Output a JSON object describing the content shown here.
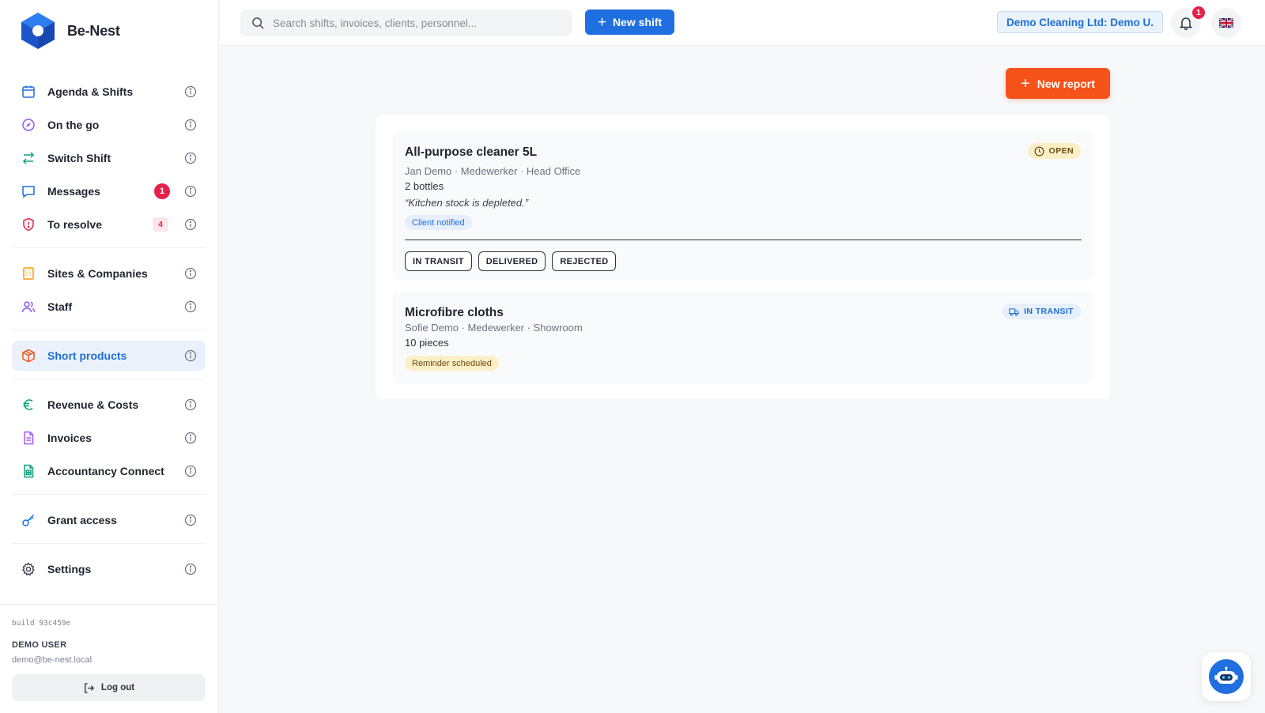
{
  "app": {
    "name": "Be-Nest",
    "colors": {
      "accent": "#1f6fe0",
      "orange": "#f5531a",
      "danger": "#e5214b"
    }
  },
  "search": {
    "placeholder": "Search shifts, invoices, clients, personnel..."
  },
  "topbar": {
    "new_shift_label": "New shift",
    "company_label": "Demo Cleaning Ltd: Demo U.",
    "notifications_count": "1",
    "language_icon": "uk-flag-icon"
  },
  "sidebar": {
    "items": [
      {
        "label": "Agenda & Shifts",
        "icon": "calendar-icon"
      },
      {
        "label": "On the go",
        "icon": "compass-icon"
      },
      {
        "label": "Switch Shift",
        "icon": "swap-icon"
      },
      {
        "label": "Messages",
        "icon": "message-icon",
        "badge": "1"
      },
      {
        "label": "To resolve",
        "icon": "shield-alert-icon",
        "badge": "4"
      },
      {
        "label": "Sites & Companies",
        "icon": "building-icon"
      },
      {
        "label": "Staff",
        "icon": "users-icon"
      },
      {
        "label": "Short products",
        "icon": "package-icon",
        "active": true
      },
      {
        "label": "Revenue & Costs",
        "icon": "euro-icon"
      },
      {
        "label": "Invoices",
        "icon": "invoice-icon"
      },
      {
        "label": "Accountancy Connect",
        "icon": "spreadsheet-icon"
      },
      {
        "label": "Grant access",
        "icon": "key-icon"
      },
      {
        "label": "Settings",
        "icon": "gear-icon"
      }
    ],
    "footer": {
      "build": "build 93c459e",
      "user_name": "DEMO USER",
      "user_email": "demo@be-nest.local",
      "logout_label": "Log out"
    }
  },
  "main": {
    "new_report_label": "New report",
    "reports": [
      {
        "title": "All-purpose cleaner 5L",
        "meta": "Jan Demo · Medewerker · Head Office",
        "quantity": "2 bottles",
        "note": "“Kitchen stock is depleted.”",
        "tag": "Client notified",
        "status": "OPEN",
        "actions": [
          "IN TRANSIT",
          "DELIVERED",
          "REJECTED"
        ]
      },
      {
        "title": "Microfibre cloths",
        "meta": "Sofie Demo · Medewerker · Showroom",
        "quantity": "10 pieces",
        "tag": "Reminder scheduled",
        "status": "IN TRANSIT"
      }
    ]
  }
}
